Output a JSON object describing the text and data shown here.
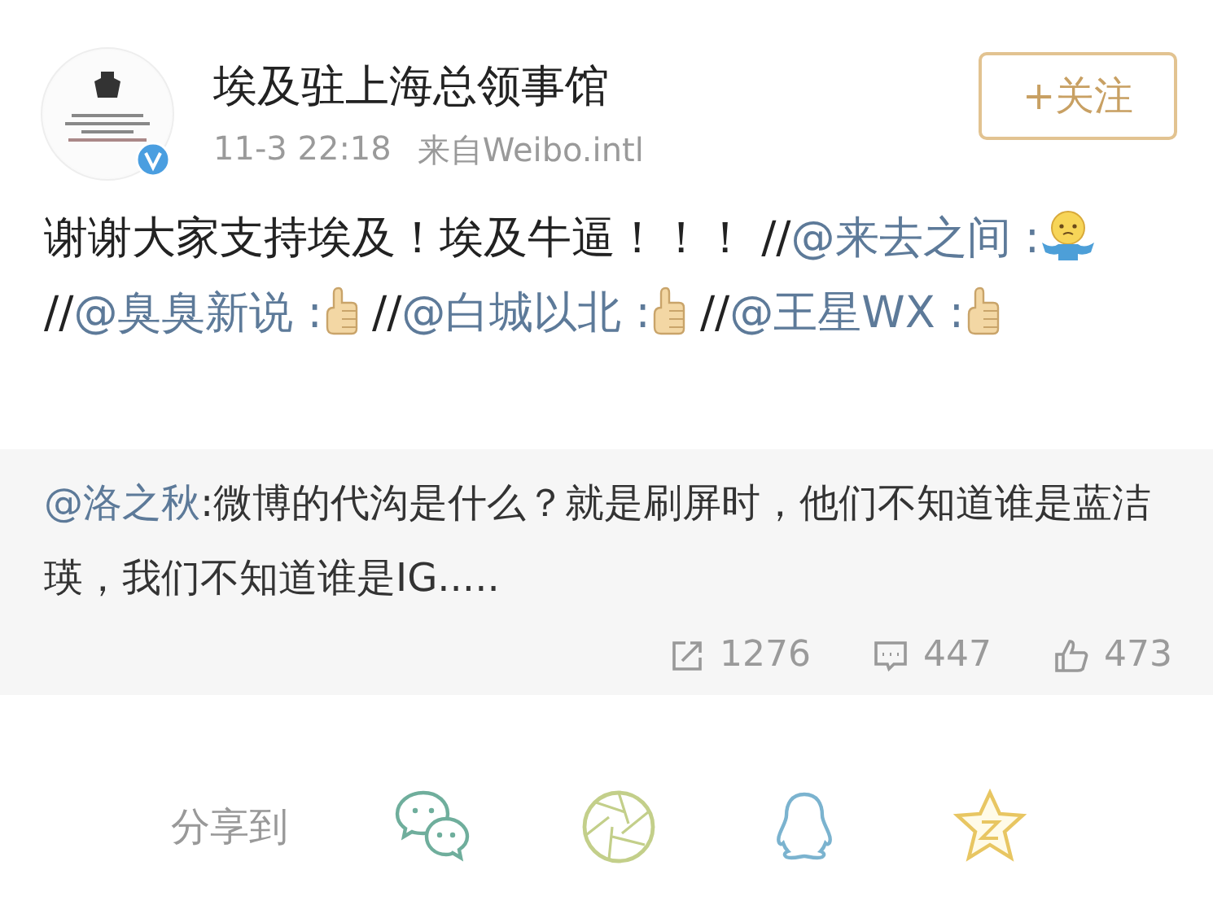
{
  "author": {
    "name": "埃及驻上海总领事馆",
    "verified": true,
    "time": "11-3 22:18",
    "source": "来自Weibo.intl"
  },
  "follow_button": {
    "label": "+关注"
  },
  "post": [
    {
      "kind": "text",
      "text": "谢谢大家支持埃及！埃及牛逼！！！ //"
    },
    {
      "kind": "mention",
      "text": "@来去之间 :"
    },
    {
      "kind": "shrug"
    },
    {
      "kind": "text",
      "text": "//"
    },
    {
      "kind": "mention",
      "text": "@臭臭新说 :"
    },
    {
      "kind": "thumb"
    },
    {
      "kind": "text",
      "text": " //"
    },
    {
      "kind": "mention",
      "text": "@白城以北 :"
    },
    {
      "kind": "thumb"
    },
    {
      "kind": "text",
      "text": " //"
    },
    {
      "kind": "mention",
      "text": "@王星WX :"
    },
    {
      "kind": "thumb"
    }
  ],
  "quoted": {
    "author": "@洛之秋",
    "text": ":微博的代沟是什么？就是刷屏时，他们不知道谁是蓝洁瑛，我们不知道谁是IG.....",
    "stats": [
      {
        "kind": "repost",
        "count": "1276"
      },
      {
        "kind": "comment",
        "count": "447"
      },
      {
        "kind": "like",
        "count": "473"
      }
    ]
  },
  "share": {
    "label": "分享到",
    "targets": [
      {
        "kind": "wechat"
      },
      {
        "kind": "moments"
      },
      {
        "kind": "qq"
      },
      {
        "kind": "qzone"
      }
    ]
  }
}
